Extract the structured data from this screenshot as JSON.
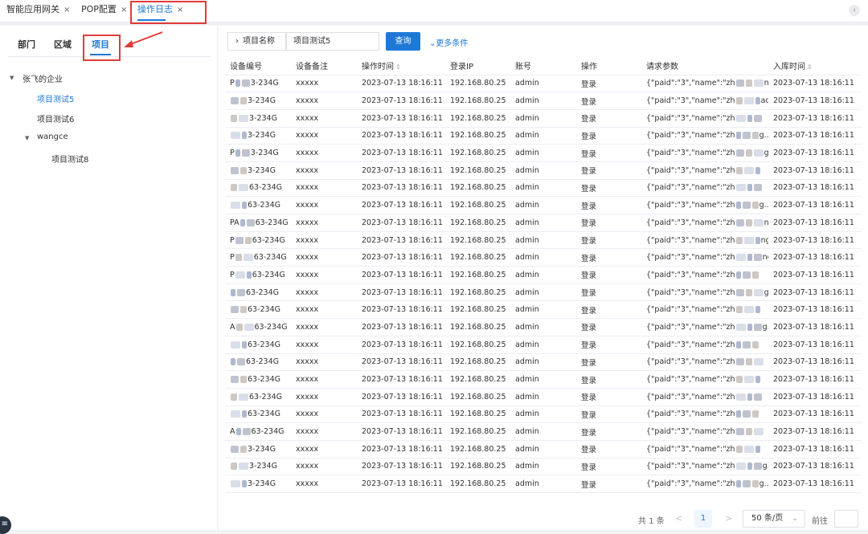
{
  "top_tabs": [
    {
      "label": "智能应用网关",
      "close": "×"
    },
    {
      "label": "POP配置",
      "close": "×"
    },
    {
      "label": "操作日志",
      "close": "×"
    }
  ],
  "tab_scroll_icon": "‹",
  "left_tabs": [
    "部门",
    "区域",
    "项目"
  ],
  "tree": {
    "root": "张飞的企业",
    "items": [
      "项目测试5",
      "项目测试6",
      "wangce",
      "项目测试8"
    ]
  },
  "filter": {
    "field_label": "项目名称",
    "value": "项目测试5",
    "query_button": "查询",
    "more_conditions": "更多条件"
  },
  "table": {
    "headers": [
      "设备编号",
      "设备备注",
      "操作时间",
      "登录IP",
      "账号",
      "操作",
      "请求参数",
      "入库时间"
    ],
    "sort_icon": "⇕",
    "device_suffixes": [
      "3-234G",
      "3-234G",
      "3-234G",
      "3-234G",
      "3-234G",
      "3-234G",
      "63-234G",
      "63-234G",
      "63-234G",
      "63-234G",
      "63-234G",
      "63-234G",
      "63-234G",
      "63-234G",
      "63-234G",
      "63-234G",
      "63-234G",
      "63-234G",
      "63-234G",
      "63-234G",
      "63-234G",
      "3-234G",
      "3-234G",
      "3-234G"
    ],
    "device_prefixes": [
      "P",
      "",
      "",
      "",
      "P",
      "",
      "",
      "",
      "PA",
      "P",
      "P",
      "P",
      "",
      "",
      "A",
      "",
      "",
      "",
      "",
      "",
      "A",
      "",
      "",
      ""
    ],
    "remark": "xxxxx",
    "op_time": "2023-07-13 18:16:11",
    "ip": "192.168.80.25",
    "account": "admin",
    "action": "登录",
    "param_prefix": "{\"paid\":\"3\",\"name\":\"zh",
    "param_tails": [
      "ng...",
      "ac",
      "",
      "g...",
      "g...",
      "",
      "",
      "g...",
      "ng...",
      "ng...",
      "ng...",
      "",
      "g...",
      "",
      "g...",
      "",
      "",
      "",
      "",
      "",
      "",
      "",
      "g...",
      "g..."
    ],
    "store_time": "2023-07-13 18:16:11",
    "row_count": 24
  },
  "pagination": {
    "total": "共 1 条",
    "prev": "<",
    "current": "1",
    "next": ">",
    "page_size": "50 条/页",
    "goto": "前往"
  },
  "float_icon": "≡"
}
